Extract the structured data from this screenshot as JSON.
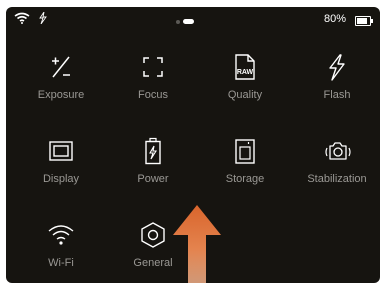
{
  "status": {
    "battery_text": "80%",
    "battery_level": 0.8,
    "page_count": 2,
    "active_page": 2
  },
  "tiles": [
    {
      "label": "Exposure",
      "icon": "exposure-icon"
    },
    {
      "label": "Focus",
      "icon": "focus-brackets-icon"
    },
    {
      "label": "Quality",
      "icon": "raw-file-icon",
      "icon_text": "RAW"
    },
    {
      "label": "Flash",
      "icon": "lightning-icon"
    },
    {
      "label": "Display",
      "icon": "display-icon"
    },
    {
      "label": "Power",
      "icon": "battery-charging-icon"
    },
    {
      "label": "Storage",
      "icon": "memory-card-icon"
    },
    {
      "label": "Stabilization",
      "icon": "camera-stabilization-icon"
    },
    {
      "label": "Wi-Fi",
      "icon": "wifi-icon"
    },
    {
      "label": "General",
      "icon": "hex-nut-icon"
    }
  ],
  "colors": {
    "background": "#161410",
    "label": "#9a9894",
    "icon": "#ffffff",
    "arrow_top": "#d9652c",
    "arrow_bottom": "#f0b08a"
  }
}
